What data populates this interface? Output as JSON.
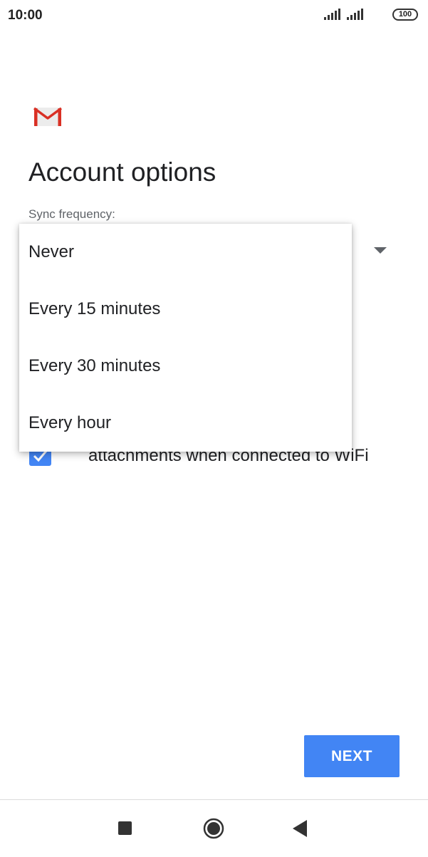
{
  "status_bar": {
    "time": "10:00",
    "battery": "100"
  },
  "page": {
    "title": "Account options",
    "sync_label": "Sync frequency:"
  },
  "dropdown": {
    "options": [
      {
        "label": "Never"
      },
      {
        "label": "Every 15 minutes"
      },
      {
        "label": "Every 30 minutes"
      },
      {
        "label": "Every hour"
      }
    ]
  },
  "wifi_option": {
    "label": "attachments when connected to WiFi",
    "checked": true
  },
  "next_button": {
    "label": "NEXT"
  },
  "icons": {
    "gmail": "gmail-logo",
    "signal": "signal-icon",
    "battery": "battery-icon",
    "dropdown": "dropdown-arrow-icon",
    "check": "check-icon",
    "recent": "recent-apps-icon",
    "home": "home-icon",
    "back": "back-icon"
  },
  "colors": {
    "accent": "#4285f4",
    "gmail_red": "#d93025",
    "text_primary": "#202124",
    "text_secondary": "#5f6368"
  }
}
